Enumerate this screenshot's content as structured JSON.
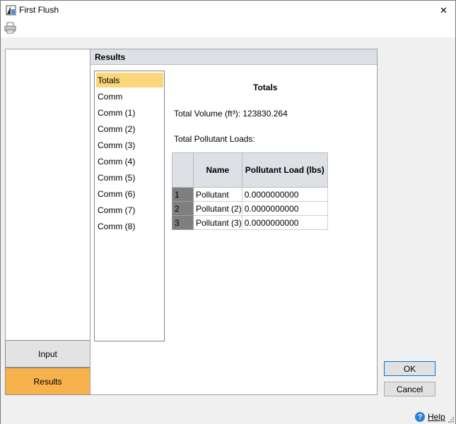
{
  "window": {
    "title": "First Flush",
    "close_glyph": "✕"
  },
  "toolbar": {
    "print_icon": "printer-icon"
  },
  "nav": {
    "buttons": [
      {
        "label": "Input",
        "selected": false
      },
      {
        "label": "Results",
        "selected": true
      }
    ]
  },
  "results": {
    "header": "Results",
    "list": [
      "Totals",
      "Comm",
      "Comm (1)",
      "Comm (2)",
      "Comm (3)",
      "Comm (4)",
      "Comm (5)",
      "Comm (6)",
      "Comm (7)",
      "Comm (8)"
    ],
    "selected_item": "Totals",
    "totals_title": "Totals",
    "total_volume": "Total Volume (ft³): 123830.264",
    "loads_label": "Total Pollutant Loads:",
    "table": {
      "columns": [
        "Name",
        "Pollutant Load (lbs)"
      ],
      "rows": [
        {
          "num": "1",
          "name": "Pollutant",
          "load": "0.0000000000"
        },
        {
          "num": "2",
          "name": "Pollutant (2)",
          "load": "0.0000000000"
        },
        {
          "num": "3",
          "name": "Pollutant (3)",
          "load": "0.0000000000"
        }
      ]
    }
  },
  "dialog": {
    "ok_label": "OK",
    "cancel_label": "Cancel",
    "help_label": "Help",
    "help_glyph": "?"
  },
  "colors": {
    "selected_nav": "#f8b24b",
    "selected_list": "#fcd67a",
    "header_bg": "#dde0e5",
    "row_header": "#7f7f7f"
  }
}
